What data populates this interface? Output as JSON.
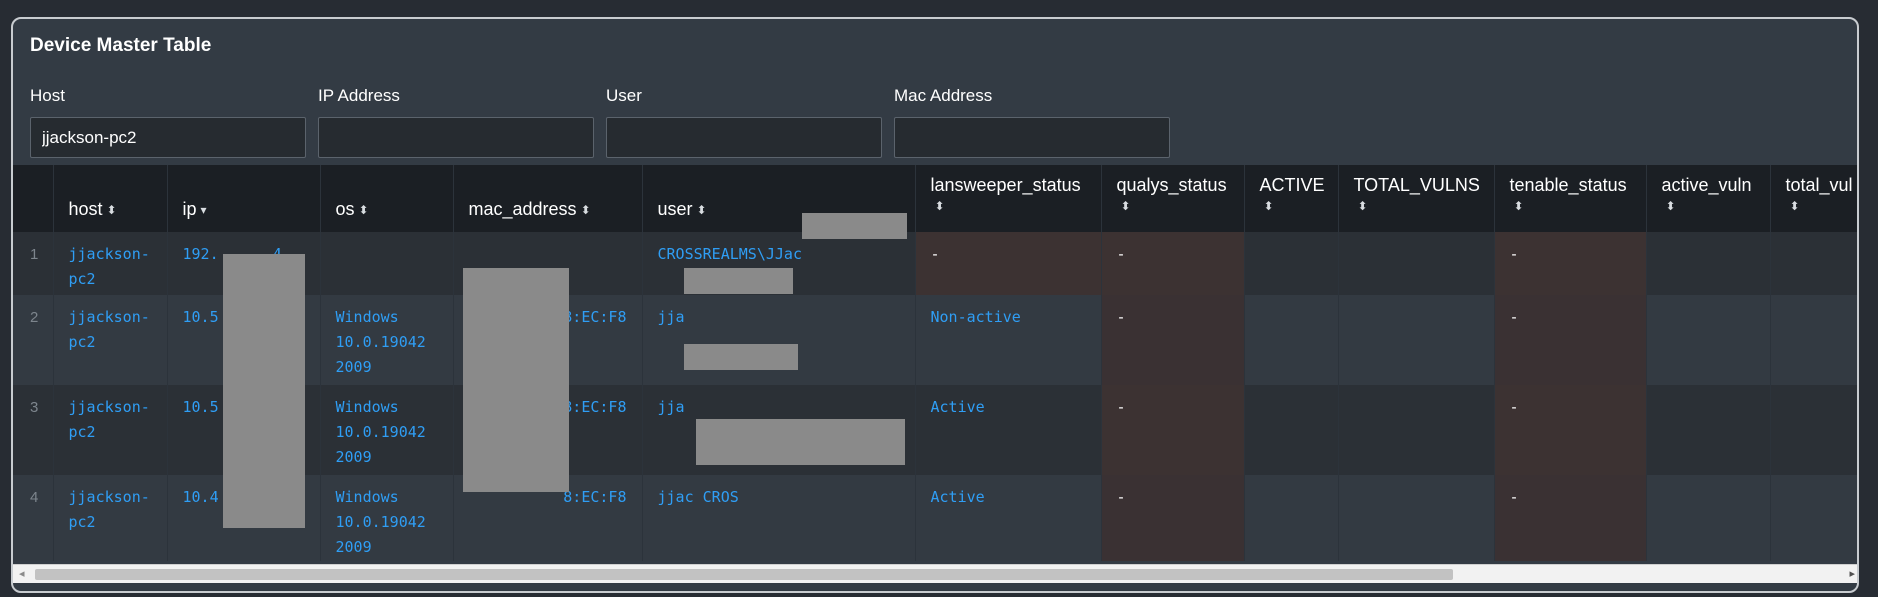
{
  "panel": {
    "title": "Device Master Table"
  },
  "filters": [
    {
      "label": "Host",
      "value": "jjackson-pc2",
      "placeholder": ""
    },
    {
      "label": "IP Address",
      "value": "",
      "placeholder": ""
    },
    {
      "label": "User",
      "value": "",
      "placeholder": ""
    },
    {
      "label": "Mac Address",
      "value": "",
      "placeholder": ""
    }
  ],
  "table": {
    "columns": [
      "host",
      "ip",
      "os",
      "mac_address",
      "user",
      "lansweeper_status",
      "qualys_status",
      "ACTIVE",
      "TOTAL_VULNS",
      "tenable_status",
      "active_vuln",
      "total_vul"
    ],
    "sort_icons": {
      "unsorted": "⬍",
      "desc": "▾"
    },
    "rows": [
      {
        "num": "1",
        "host": "jjackson-pc2",
        "ip": "192.      4",
        "os": "",
        "mac": "",
        "user": "CROSSREALMS\\JJac",
        "lansweeper": "-",
        "qualys": "-",
        "active": "",
        "total_vulns": "",
        "tenable": "-",
        "active_vuln": "",
        "total_vul": ""
      },
      {
        "num": "2",
        "host": "jjackson-pc2",
        "ip": "10.5",
        "os": "Windows 10.0.19042 2009",
        "mac": "8:EC:F8",
        "user": "jja",
        "lansweeper": "Non-active",
        "qualys": "-",
        "active": "",
        "total_vulns": "",
        "tenable": "-",
        "active_vuln": "",
        "total_vul": ""
      },
      {
        "num": "3",
        "host": "jjackson-pc2",
        "ip": "10.5",
        "os": "Windows 10.0.19042 2009",
        "mac": "8:EC:F8",
        "user": "jja",
        "lansweeper": "Active",
        "qualys": "-",
        "active": "",
        "total_vulns": "",
        "tenable": "-",
        "active_vuln": "",
        "total_vul": ""
      },
      {
        "num": "4",
        "host": "jjackson-pc2",
        "ip": "10.4",
        "os": "Windows 10.0.19042 2009",
        "mac": "8:EC:F8",
        "user": "jjac CROS",
        "lansweeper": "Active",
        "qualys": "-",
        "active": "",
        "total_vulns": "",
        "tenable": "-",
        "active_vuln": "",
        "total_vul": ""
      }
    ]
  },
  "scrollbar": {
    "left_arrow": "◂",
    "right_arrow": "▸"
  },
  "colors": {
    "link": "#2f9ef5",
    "panel_bg": "#333b44",
    "header_bg": "#1b1f24",
    "status_cell_bg": "#3c3232"
  }
}
